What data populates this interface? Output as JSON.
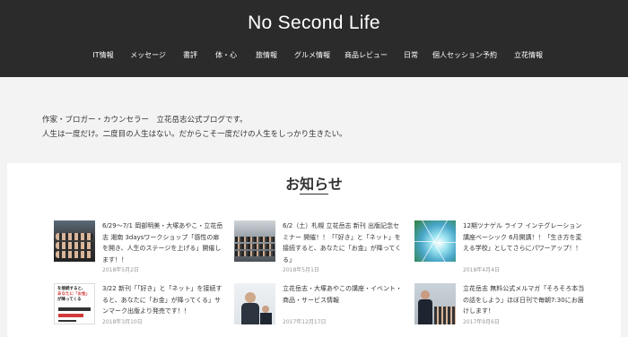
{
  "header": {
    "site_title": "No Second Life",
    "nav": [
      {
        "label": "IT情報",
        "name": "nav-item-it"
      },
      {
        "label": "メッセージ",
        "name": "nav-item-message"
      },
      {
        "label": "書評",
        "name": "nav-item-book-review"
      },
      {
        "label": "体・心",
        "name": "nav-item-body-mind"
      },
      {
        "label": "旅情報",
        "name": "nav-item-travel"
      },
      {
        "label": "グルメ情報",
        "name": "nav-item-gourmet"
      },
      {
        "label": "商品レビュー",
        "name": "nav-item-product-review"
      },
      {
        "label": "日常",
        "name": "nav-item-daily"
      },
      {
        "label": "個人セッション予約",
        "name": "nav-item-session-booking"
      },
      {
        "label": "立花情報",
        "name": "nav-item-tachibana"
      }
    ]
  },
  "intro": {
    "line1": "作家・ブロガー・カウンセラー　立花岳志公式ブログです。",
    "line2": "人生は一度だけ。二度目の人生はない。だからこそ一度だけの人生をしっかり生きたい。"
  },
  "news": {
    "heading": "お知らせ",
    "items": [
      {
        "title": "6/29〜7/1 岡部明美・大塚あやこ・立花岳志 湘南 3daysワークショップ「感性の扉を開き、人生のステージを上げる」開催します！！",
        "date": "2018年5月2日",
        "thumb": "workshop-group-photo"
      },
      {
        "title": "6/2（土）札幌 立花岳志 新刊 出版記念セミナー 開催！！「「好き」と「ネット」を接続すると、あなたに「お金」が降ってくる」",
        "date": "2018年5月1日",
        "thumb": "seminar-audience-photo"
      },
      {
        "title": "12期ツナゲル ライフ インテグレーション講座ベーシック 6月開講！！「生き方を変える学校」としてさらにパワーアップ！！",
        "date": "2018年4月4日",
        "thumb": "sunlight-leaves-photo"
      },
      {
        "title": "3/22 新刊「「好き」と「ネット」を接続すると、あなたに「お金」が降ってくる」サンマーク出版より発売です！！",
        "date": "2018年3月10日",
        "thumb": "book-cover"
      },
      {
        "title": "立花岳志・大塚あやこの講座・イベント・商品・サービス情報",
        "date": "2017年12月17日",
        "thumb": "speaker-photo"
      },
      {
        "title": "立花岳志 無料公式メルマガ「そろそろ本当の話をしよう」ほぼ日刊で毎朝7:30にお届けします！",
        "date": "2017年9月6日",
        "thumb": "lecture-photo"
      }
    ]
  },
  "book_cover": {
    "line1": "を接続すると、",
    "line2": "あなたに「お金」",
    "line3": "が降ってくる"
  }
}
